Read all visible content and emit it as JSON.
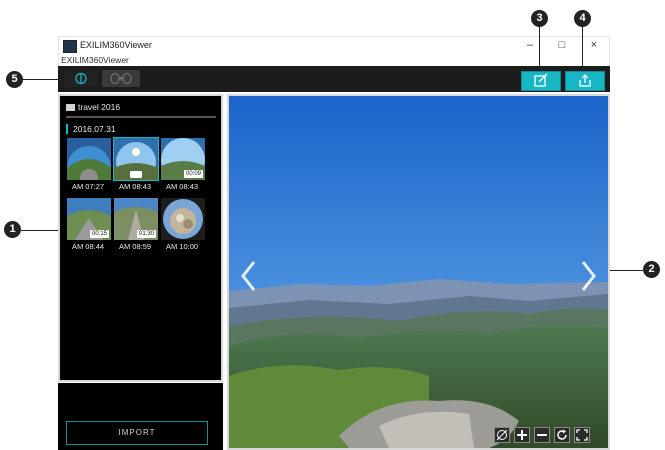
{
  "window": {
    "title": "EXILIM360Viewer",
    "menu_label": "EXILIM360Viewer",
    "minimize_label": "–",
    "maximize_label": "□",
    "close_label": "×"
  },
  "browser": {
    "folder_name": "travel 2016",
    "date_heading": "2016.07.31",
    "thumbnails": [
      {
        "time": "AM 07:27",
        "badge": ""
      },
      {
        "time": "AM 08:43",
        "badge": ""
      },
      {
        "time": "AM 08:43",
        "badge": "00:09"
      },
      {
        "time": "AM 08:44",
        "badge": "00:15"
      },
      {
        "time": "AM 08:59",
        "badge": "01:30"
      },
      {
        "time": "AM 10:00",
        "badge": ""
      }
    ],
    "import_label": "IMPORT"
  },
  "callouts": {
    "c1": "1",
    "c2": "2",
    "c3": "3",
    "c4": "4",
    "c5": "5"
  },
  "icons": {
    "edit": "edit-icon",
    "share": "share-icon",
    "prev": "chevron-left-icon",
    "next": "chevron-right-icon"
  },
  "colors": {
    "accent": "#17b6c4",
    "panel_bg": "#000000",
    "toolbar_bg": "#1c1c1c"
  }
}
